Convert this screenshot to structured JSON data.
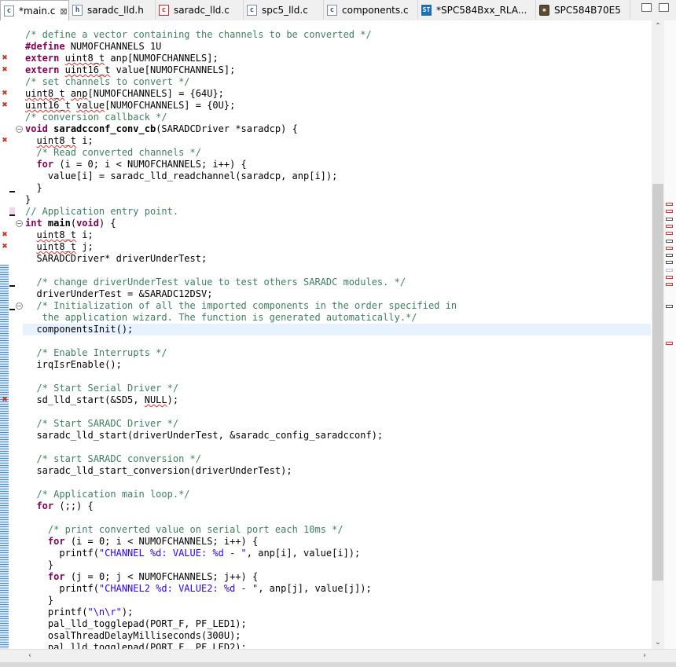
{
  "tabs": [
    {
      "icon": "c-file-icon",
      "icon_text": "c",
      "label": "*main.c",
      "closable": true,
      "active": true,
      "error": false
    },
    {
      "icon": "h-file-icon",
      "icon_text": "h",
      "label": "saradc_lld.h",
      "closable": false,
      "active": false,
      "error": false
    },
    {
      "icon": "c-file-error-icon",
      "icon_text": "c",
      "label": "saradc_lld.c",
      "closable": false,
      "active": false,
      "error": true
    },
    {
      "icon": "c-file-icon",
      "icon_text": "c",
      "label": "spc5_lld.c",
      "closable": false,
      "active": false,
      "error": false
    },
    {
      "icon": "c-file-icon",
      "icon_text": "c",
      "label": "components.c",
      "closable": false,
      "active": false,
      "error": false
    },
    {
      "icon": "st-application-icon",
      "icon_text": "ST",
      "label": "*SPC584Bxx_RLA...",
      "closable": false,
      "active": false,
      "error": false
    },
    {
      "icon": "chip-icon",
      "icon_text": "▪",
      "label": "SPC584B70E5",
      "closable": false,
      "active": false,
      "error": false
    }
  ],
  "tab_close_glyph": "⊠",
  "code_lines": [
    [
      {
        "t": "/* define a vector containing the channels to be converted */",
        "c": "cm"
      }
    ],
    [
      {
        "t": "#define",
        "c": "pp"
      },
      {
        "t": " NUMOFCHANNELS 1U"
      }
    ],
    [
      {
        "t": "extern",
        "c": "kw"
      },
      {
        "t": " "
      },
      {
        "t": "uint8_t",
        "c": "ul"
      },
      {
        "t": " anp[NUMOFCHANNELS];"
      }
    ],
    [
      {
        "t": "extern",
        "c": "kw"
      },
      {
        "t": " "
      },
      {
        "t": "uint16_t",
        "c": "ul"
      },
      {
        "t": " value[NUMOFCHANNELS];"
      }
    ],
    [
      {
        "t": "/* set channels to convert */",
        "c": "cm"
      }
    ],
    [
      {
        "t": "uint8_t",
        "c": "ul"
      },
      {
        "t": " "
      },
      {
        "t": "anp",
        "c": "ul"
      },
      {
        "t": "[NUMOFCHANNELS] = {64U};"
      }
    ],
    [
      {
        "t": "uint16_t",
        "c": "ul"
      },
      {
        "t": " "
      },
      {
        "t": "value",
        "c": "ul"
      },
      {
        "t": "[NUMOFCHANNELS] = {0U};"
      }
    ],
    [
      {
        "t": "/* conversion callback */",
        "c": "cm"
      }
    ],
    [
      {
        "t": "void",
        "c": "kw"
      },
      {
        "t": " "
      },
      {
        "t": "saradcconf_conv_cb",
        "c": "fn"
      },
      {
        "t": "(SARADCDriver *saradcp) {"
      }
    ],
    [
      {
        "t": "  "
      },
      {
        "t": "uint8_t",
        "c": "ul"
      },
      {
        "t": " i;"
      }
    ],
    [
      {
        "t": "  "
      },
      {
        "t": "/* Read converted channels */",
        "c": "cm"
      }
    ],
    [
      {
        "t": "  "
      },
      {
        "t": "for",
        "c": "kw"
      },
      {
        "t": " (i = 0; i < NUMOFCHANNELS; i++) {"
      }
    ],
    [
      {
        "t": "    value[i] = saradc_lld_readchannel(saradcp, anp[i]);"
      }
    ],
    [
      {
        "t": "  }"
      }
    ],
    [
      {
        "t": "}"
      }
    ],
    [
      {
        "t": "// Application entry point.",
        "c": "cm"
      }
    ],
    [
      {
        "t": "int",
        "c": "kw"
      },
      {
        "t": " "
      },
      {
        "t": "main",
        "c": "fn"
      },
      {
        "t": "("
      },
      {
        "t": "void",
        "c": "kw"
      },
      {
        "t": ") {"
      }
    ],
    [
      {
        "t": "  "
      },
      {
        "t": "uint8_t",
        "c": "ul"
      },
      {
        "t": " i;"
      }
    ],
    [
      {
        "t": "  "
      },
      {
        "t": "uint8_t",
        "c": "ul"
      },
      {
        "t": " j;"
      }
    ],
    [
      {
        "t": "  SARADCDriver* driverUnderTest;"
      }
    ],
    [
      {
        "t": ""
      }
    ],
    [
      {
        "t": "  "
      },
      {
        "t": "/* change driverUnderTest value to test others SARADC modules. */",
        "c": "cm"
      }
    ],
    [
      {
        "t": "  driverUnderTest = &SARADC12DSV;"
      }
    ],
    [
      {
        "t": "  "
      },
      {
        "t": "/* Initialization of all the imported components in the order specified in",
        "c": "cm"
      }
    ],
    [
      {
        "t": "   the application wizard. The function is generated automatically.*/",
        "c": "cm"
      }
    ],
    [
      {
        "t": "  componentsInit();"
      }
    ],
    [
      {
        "t": ""
      }
    ],
    [
      {
        "t": "  "
      },
      {
        "t": "/* Enable Interrupts */",
        "c": "cm"
      }
    ],
    [
      {
        "t": "  irqIsrEnable();"
      }
    ],
    [
      {
        "t": ""
      }
    ],
    [
      {
        "t": "  "
      },
      {
        "t": "/* Start Serial Driver */",
        "c": "cm"
      }
    ],
    [
      {
        "t": "  sd_lld_start(&SD5, "
      },
      {
        "t": "NULL",
        "c": "ul"
      },
      {
        "t": ");"
      }
    ],
    [
      {
        "t": ""
      }
    ],
    [
      {
        "t": "  "
      },
      {
        "t": "/* Start SARADC Driver */",
        "c": "cm"
      }
    ],
    [
      {
        "t": "  saradc_lld_start(driverUnderTest, &saradc_config_saradcconf);"
      }
    ],
    [
      {
        "t": ""
      }
    ],
    [
      {
        "t": "  "
      },
      {
        "t": "/* start SARADC conversion */",
        "c": "cm"
      }
    ],
    [
      {
        "t": "  saradc_lld_start_conversion(driverUnderTest);"
      }
    ],
    [
      {
        "t": ""
      }
    ],
    [
      {
        "t": "  "
      },
      {
        "t": "/* Application main loop.*/",
        "c": "cm"
      }
    ],
    [
      {
        "t": "  "
      },
      {
        "t": "for",
        "c": "kw"
      },
      {
        "t": " (;;) {"
      }
    ],
    [
      {
        "t": ""
      }
    ],
    [
      {
        "t": "    "
      },
      {
        "t": "/* print converted value on serial port each 10ms */",
        "c": "cm"
      }
    ],
    [
      {
        "t": "    "
      },
      {
        "t": "for",
        "c": "kw"
      },
      {
        "t": " (i = 0; i < NUMOFCHANNELS; i++) {"
      }
    ],
    [
      {
        "t": "      printf("
      },
      {
        "t": "\"CHANNEL %d: VALUE: %d - \"",
        "c": "str"
      },
      {
        "t": ", anp[i], value[i]);"
      }
    ],
    [
      {
        "t": "    }"
      }
    ],
    [
      {
        "t": "    "
      },
      {
        "t": "for",
        "c": "kw"
      },
      {
        "t": " (j = 0; j < NUMOFCHANNELS; j++) {"
      }
    ],
    [
      {
        "t": "      printf("
      },
      {
        "t": "\"CHANNEL2 %d: VALUE2: %d - \"",
        "c": "str"
      },
      {
        "t": ", anp[j], value[j]);"
      }
    ],
    [
      {
        "t": "    }"
      }
    ],
    [
      {
        "t": "    printf("
      },
      {
        "t": "\"\\n\\r\"",
        "c": "str"
      },
      {
        "t": ");"
      }
    ],
    [
      {
        "t": "    pal_lld_togglepad(PORT_F, PF_LED1);"
      }
    ],
    [
      {
        "t": "    osalThreadDelayMilliseconds(300U);"
      }
    ],
    [
      {
        "t": "    pal_lld_togglepad(PORT_F, PF_LED2);"
      }
    ]
  ],
  "current_line": 25,
  "error_marker_lines": [
    2,
    3,
    5,
    6,
    9,
    17,
    18,
    31
  ],
  "fold_lines": [
    8,
    16,
    23
  ],
  "quickdiff_lines": [
    13,
    15,
    21,
    23
  ],
  "changed_lines": [
    15
  ],
  "overview_marks": [
    {
      "line": 15,
      "kind": "error"
    },
    {
      "line": 16,
      "kind": "error"
    },
    {
      "line": 17,
      "kind": "dark"
    },
    {
      "line": 18,
      "kind": "error"
    },
    {
      "line": 19,
      "kind": "error"
    },
    {
      "line": 20,
      "kind": "dark"
    },
    {
      "line": 21,
      "kind": "error"
    },
    {
      "line": 22,
      "kind": "dark"
    },
    {
      "line": 23,
      "kind": "dark"
    },
    {
      "line": 24,
      "kind": "light"
    },
    {
      "line": 25,
      "kind": "error"
    },
    {
      "line": 26,
      "kind": "error"
    },
    {
      "line": 29,
      "kind": "dark"
    },
    {
      "line": 34,
      "kind": "error"
    }
  ],
  "scrollbar_glyphs": {
    "up": "⌃",
    "down": "⌄",
    "left": "‹",
    "right": "›"
  },
  "fold_glyph": "−",
  "error_marker_glyph": "✖"
}
